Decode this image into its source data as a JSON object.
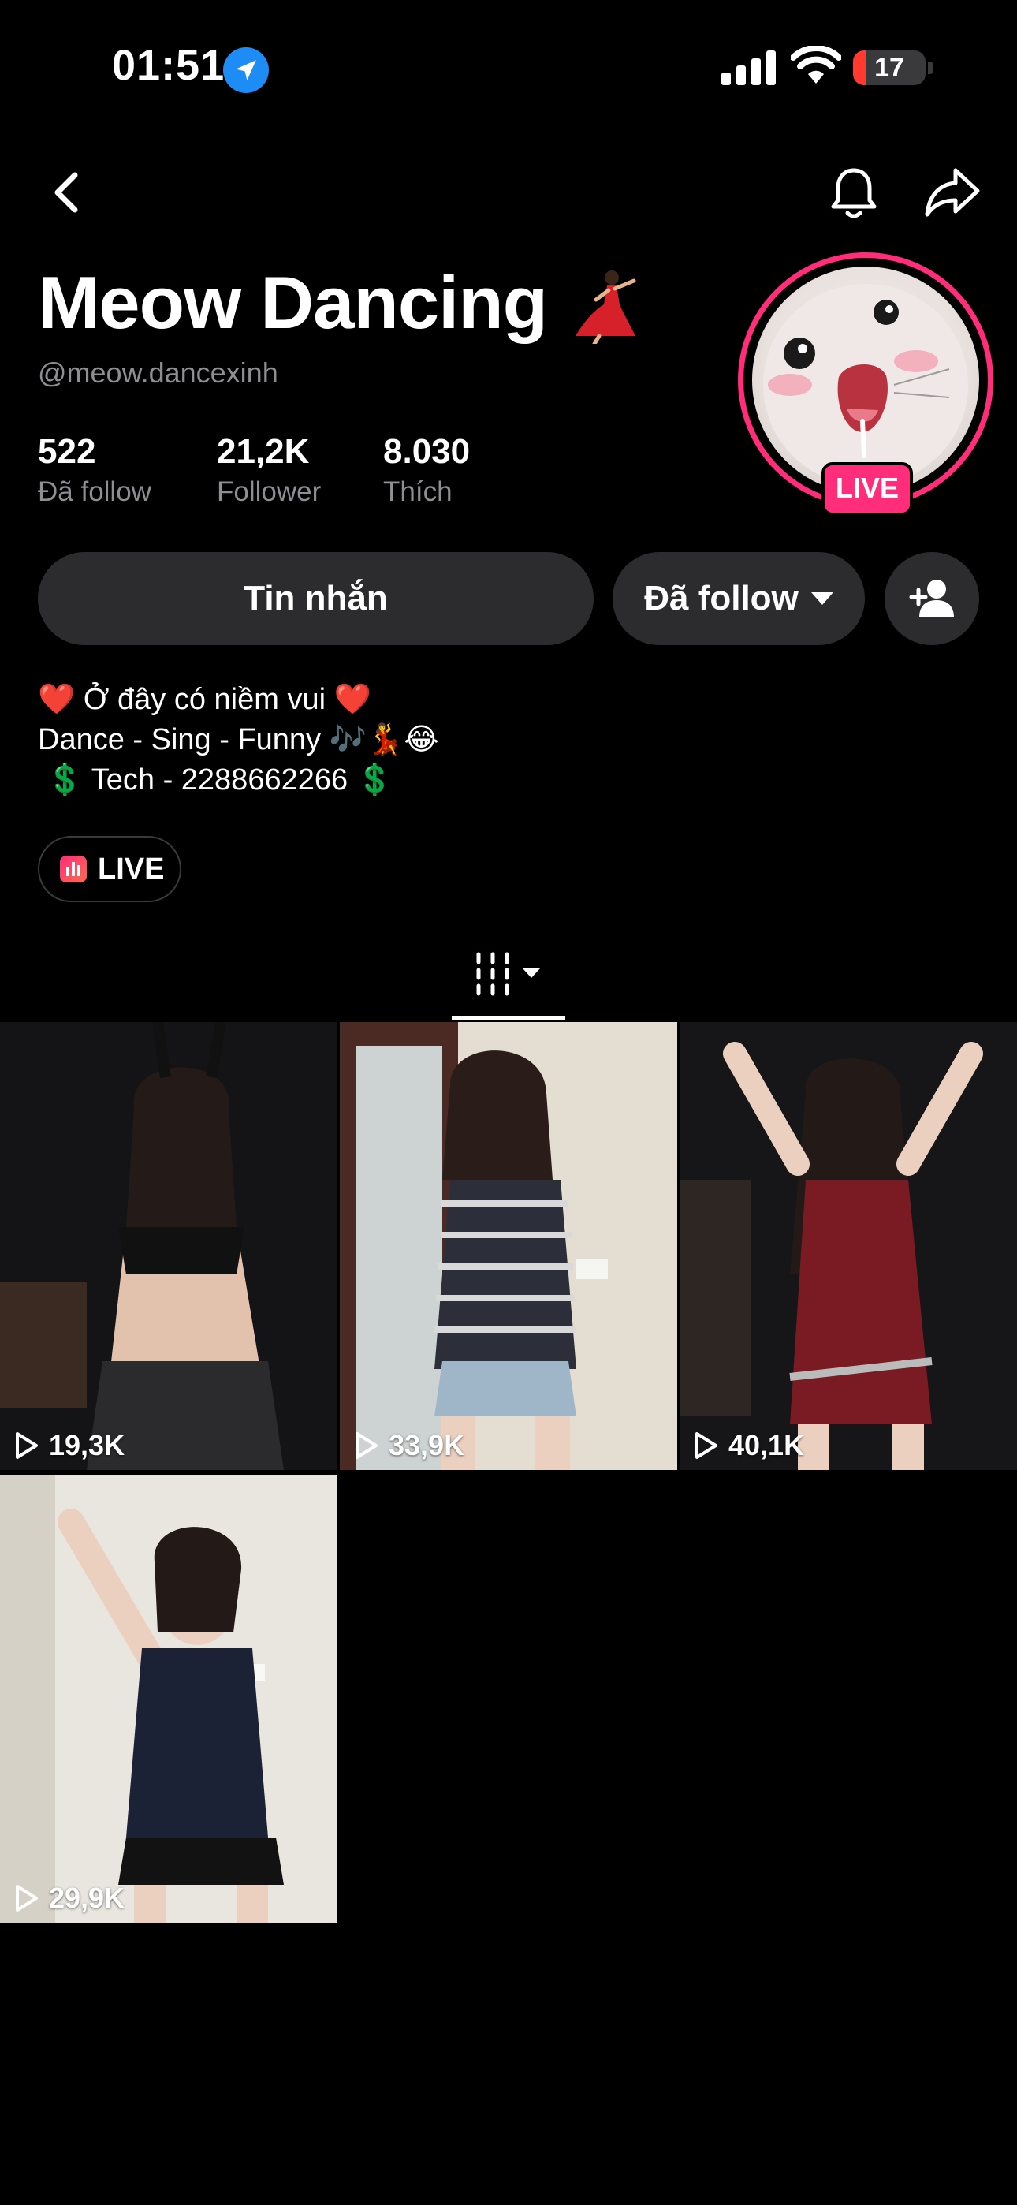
{
  "status_bar": {
    "time": "01:51",
    "battery": "17",
    "battery_level": 0.17,
    "battery_color": "#ff3b30"
  },
  "nav": {
    "back_icon": "chevron-left-icon",
    "bell_icon": "bell-icon",
    "share_icon": "share-arrow-icon"
  },
  "profile": {
    "name": "Meow Dancing",
    "name_emoji": "dancer-emoji",
    "handle": "@meow.dancexinh",
    "live_badge": "LIVE",
    "accent": "#ff2d7a",
    "stats": [
      {
        "value": "522",
        "label": "Đã follow"
      },
      {
        "value": "21,2K",
        "label": "Follower"
      },
      {
        "value": "8.030",
        "label": "Thích"
      }
    ]
  },
  "actions": {
    "message_label": "Tin nhắn",
    "follow_label": "Đã follow",
    "add_friend_icon": "add-user-icon"
  },
  "bio": {
    "line1": "❤️ Ở đây có niềm vui ❤️",
    "line2": "Dance - Sing - Funny 🎶💃😂",
    "line3": " 💲 Tech - 2288662266 💲"
  },
  "live_pill": {
    "label": "LIVE"
  },
  "tabs": {
    "grid_icon": "grid-columns-icon"
  },
  "videos": [
    {
      "views": "19,3K"
    },
    {
      "views": "33,9K"
    },
    {
      "views": "40,1K"
    },
    {
      "views": "29,9K"
    }
  ]
}
